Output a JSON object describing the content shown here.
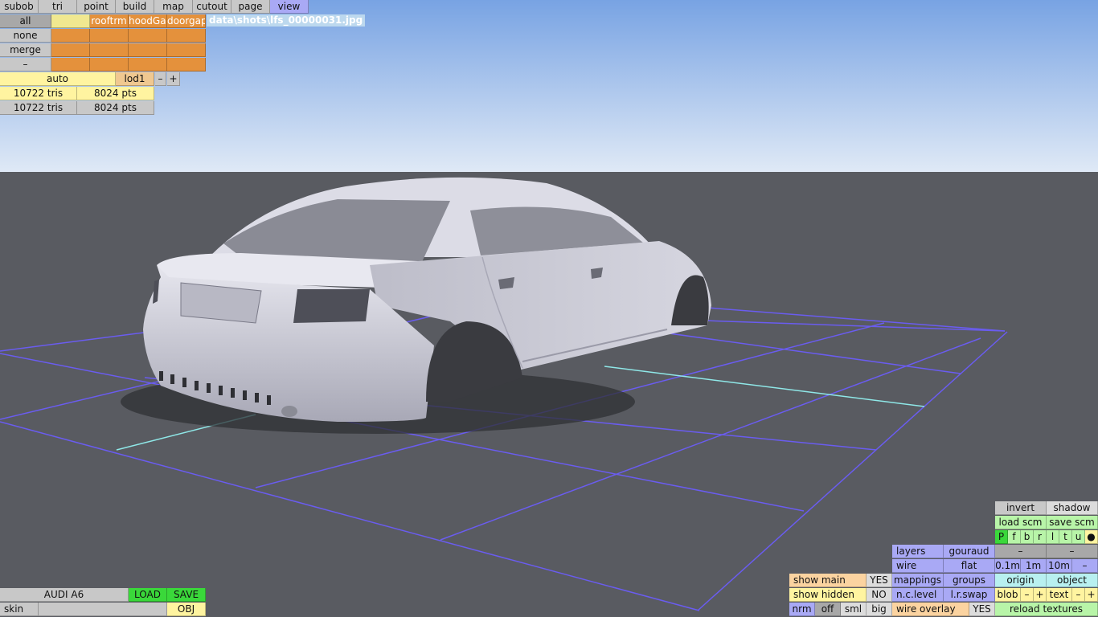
{
  "window": {
    "title": "data\\shots\\lfs_00000031.jpg"
  },
  "menu": [
    "subob",
    "tri",
    "point",
    "build",
    "map",
    "cutout",
    "page",
    "view"
  ],
  "menu_active": "view",
  "left_panel": {
    "rows": [
      "all",
      "none",
      "merge",
      "–"
    ],
    "columns": [
      "",
      "rooftrm",
      "hoodGap",
      "doorgap"
    ],
    "auto": "auto",
    "lod": "lod1",
    "lod_minus": "–",
    "lod_plus": "+",
    "stats": [
      {
        "tris": "10722 tris",
        "pts": "8024 pts"
      },
      {
        "tris": "10722 tris",
        "pts": "8024 pts"
      }
    ]
  },
  "bottom_left": {
    "car_name": "AUDI A6",
    "load": "LOAD",
    "save": "SAVE",
    "skin": "skin",
    "obj": "OBJ"
  },
  "bottom_right": {
    "invert": "invert",
    "shadow": "shadow",
    "load_scm": "load scm",
    "save_scm": "save scm",
    "view_letters": [
      "P",
      "f",
      "b",
      "r",
      "l",
      "t",
      "u",
      "●"
    ],
    "layers": "layers",
    "gouraud": "gouraud",
    "dash1": "–",
    "dash2": "–",
    "wire": "wire",
    "flat": "flat",
    "grid_01": "0.1m",
    "grid_1": "1m",
    "grid_10": "10m",
    "grid_minus": "–",
    "show_main": "show main",
    "show_main_val": "YES",
    "mappings": "mappings",
    "groups": "groups",
    "origin": "origin",
    "object": "object",
    "show_hidden": "show hidden",
    "show_hidden_val": "NO",
    "nc_level": "n.c.level",
    "lr_swap": "l.r.swap",
    "blob": "blob",
    "blob_minus": "–",
    "blob_plus": "+",
    "text": "text",
    "text_minus": "–",
    "text_plus": "+",
    "nrm": "nrm",
    "off": "off",
    "sml": "sml",
    "big": "big",
    "wire_overlay": "wire overlay",
    "wire_overlay_val": "YES",
    "reload_textures": "reload textures"
  },
  "colors": {
    "sky_top": "#7aa6e6",
    "ground": "#595b61",
    "grid": "#6a5cf0",
    "axis": "#8fe8e8",
    "car": "#c9c9d3"
  }
}
